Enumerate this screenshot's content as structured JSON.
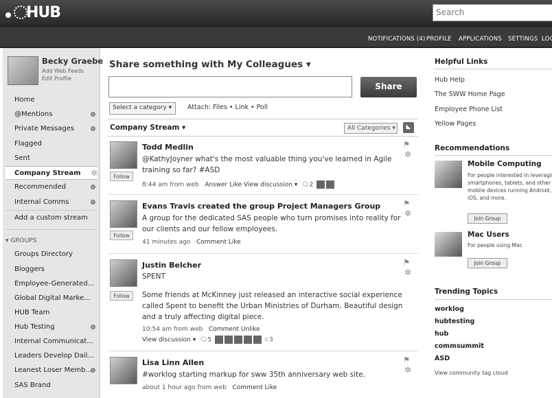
{
  "header": {
    "logo_text": "HUB",
    "search_placeholder": "Search",
    "nav": [
      "NOTIFICATIONS (4)",
      "PROFILE",
      "APPLICATIONS",
      "SETTINGS",
      "LOG"
    ]
  },
  "profile": {
    "name": "Becky Graebe",
    "links": [
      "Add Web Feeds",
      "Edit Profile"
    ]
  },
  "sidebar": {
    "items": [
      {
        "label": "Home"
      },
      {
        "label": "@Mentions"
      },
      {
        "label": "Private Messages"
      },
      {
        "label": "Flagged"
      },
      {
        "label": "Sent"
      },
      {
        "label": "Company Stream"
      },
      {
        "label": "Recommended"
      },
      {
        "label": "Internal Comms"
      },
      {
        "label": "Add a custom stream"
      }
    ],
    "groups_header": "▾ GROUPS",
    "groups": [
      {
        "label": "Groups Directory"
      },
      {
        "label": "Bloggers"
      },
      {
        "label": "Employee-Generated..."
      },
      {
        "label": "Global Digital Marke..."
      },
      {
        "label": "HUB Team"
      },
      {
        "label": "Hub Testing"
      },
      {
        "label": "Internal Communicat..."
      },
      {
        "label": "Leaders Develop Dail..."
      },
      {
        "label": "Leanest Loser Memb..."
      },
      {
        "label": "SAS Brand"
      }
    ]
  },
  "share": {
    "prefix": "Share something with",
    "audience": "My Colleagues ▾",
    "button": "Share",
    "category": "Select a category ▾",
    "attach": "Attach: Files • Link • Poll"
  },
  "stream": {
    "label": "Company Stream ▾",
    "filter": "All Categories ▾",
    "follow_label": "Follow",
    "posts": [
      {
        "author": "Todd Medlin",
        "text": "@KathyJoyner what's the most valuable thing you've learned in Agile training so far? #ASD",
        "meta": "8:44 am from web",
        "actions": "Answer  Like  View discussion ▾",
        "count": "2"
      },
      {
        "author": "Evans Travis created the group",
        "group": "Project Managers Group",
        "text": "A group for the dedicated SAS people who turn promises into reality for our clients and our fellow employees.",
        "meta": "41 minutes ago",
        "actions": "Comment  Like"
      },
      {
        "author": "Justin Belcher",
        "subtitle": "SPENT",
        "text": "Some friends at McKinney just released an interactive social experience called Spent to benefit the Urban Ministries of Durham. Beautiful design and a truly affecting digital piece.",
        "meta": "10:54 am from web",
        "actions": "Comment  Unlike",
        "discussion": "View discussion ▾",
        "count": "5",
        "stars": "3"
      },
      {
        "author": "Lisa Linn Allen",
        "text": "#worklog starting markup for sww 35th anniversary web site.",
        "meta": "about 1 hour ago from web",
        "actions": "Comment  Like"
      }
    ]
  },
  "right": {
    "helpful_header": "Helpful Links",
    "helpful_links": [
      "Hub Help",
      "The SWW Home Page",
      "Employee Phone List",
      "Yellow Pages"
    ],
    "recs_header": "Recommendations",
    "recs": [
      {
        "title": "Mobile Computing",
        "desc": [
          "For people interested in leveraging",
          "smartphones, tablets, and other",
          "mobile devices running Android,",
          "iOS, and more."
        ],
        "button": "Join Group"
      },
      {
        "title": "Mac Users",
        "desc": [
          "For people using Mac"
        ],
        "button": "Join Group"
      }
    ],
    "trending_header": "Trending Topics",
    "tags": [
      "worklog",
      "hubtesting",
      "hub",
      "commsummit",
      "ASD"
    ],
    "tag_cloud": "View community tag cloud"
  }
}
